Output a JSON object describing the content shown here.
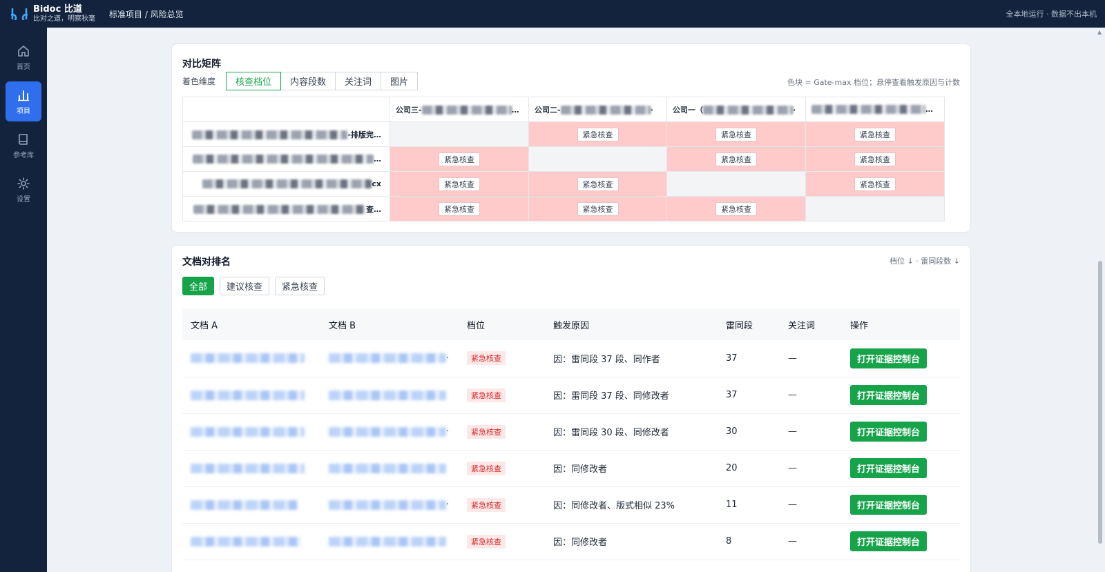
{
  "topbar": {
    "brand_name": "Bidoc 比道",
    "brand_tagline": "比对之道，明察秋毫",
    "breadcrumb": "标准项目 / 风险总览",
    "status": "全本地运行 · 数据不出本机"
  },
  "sidebar": {
    "items": [
      {
        "label": "首页",
        "icon": "home-icon"
      },
      {
        "label": "项目",
        "icon": "bar-chart-icon",
        "active": true
      },
      {
        "label": "参考库",
        "icon": "book-icon"
      },
      {
        "label": "设置",
        "icon": "gear-icon"
      }
    ]
  },
  "matrix_card": {
    "title": "对比矩阵",
    "dimension_label": "着色维度",
    "tabs": [
      "核查档位",
      "内容段数",
      "关注词",
      "图片"
    ],
    "active_tab": "核查档位",
    "legend_note": "色块 = Gate-max 档位；悬停查看触发原因与计数",
    "columns": [
      "公司三-",
      "公司二-",
      "公司一（",
      ""
    ],
    "rows": [
      {
        "label_suffix": "-排版完…",
        "cells": [
          "self",
          "紧急核查",
          "紧急核查",
          "紧急核查"
        ]
      },
      {
        "label_suffix": "…",
        "cells": [
          "紧急核查",
          "self",
          "紧急核查",
          "紧急核查"
        ]
      },
      {
        "label_suffix": "cx",
        "cells": [
          "紧急核查",
          "紧急核查",
          "self",
          "紧急核查"
        ]
      },
      {
        "label_suffix": "查…",
        "cells": [
          "紧急核查",
          "紧急核查",
          "紧急核查",
          "self"
        ]
      }
    ],
    "colors": {
      "hot": "#fecaca",
      "self": "#f3f4f6",
      "accent": "#16a34a"
    }
  },
  "ranking_card": {
    "title": "文档对排名",
    "sort_note": "档位 ↓ · 雷同段数 ↓",
    "filters": [
      "全部",
      "建议核查",
      "紧急核查"
    ],
    "active_filter": "全部",
    "headers": [
      "文档 A",
      "文档 B",
      "档位",
      "触发原因",
      "雷同段",
      "关注词",
      "操作"
    ],
    "rows": [
      {
        "level": "紧急核查",
        "reason": "因：雷同段 37 段、同作者",
        "count": "37",
        "keywords": "—",
        "action": "打开证据控制台"
      },
      {
        "level": "紧急核查",
        "reason": "因：雷同段 37 段、同修改者",
        "count": "37",
        "keywords": "—",
        "action": "打开证据控制台"
      },
      {
        "level": "紧急核查",
        "reason": "因：雷同段 30 段、同修改者",
        "count": "30",
        "keywords": "—",
        "action": "打开证据控制台"
      },
      {
        "level": "紧急核查",
        "reason": "因：同修改者",
        "count": "20",
        "keywords": "—",
        "action": "打开证据控制台"
      },
      {
        "level": "紧急核查",
        "reason": "因：同修改者、版式相似 23%",
        "count": "11",
        "keywords": "—",
        "action": "打开证据控制台"
      },
      {
        "level": "紧急核查",
        "reason": "因：同修改者",
        "count": "8",
        "keywords": "—",
        "action": "打开证据控制台"
      }
    ]
  }
}
